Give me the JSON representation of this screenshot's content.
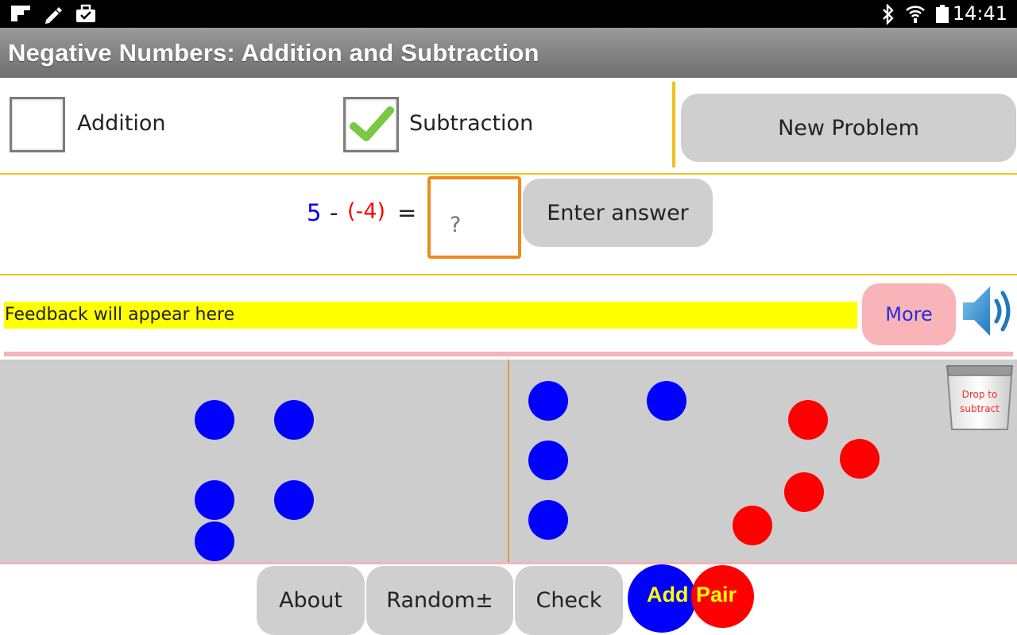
{
  "status_bar": {
    "time": "14:41",
    "icons": [
      "app-icon",
      "pencil-icon",
      "briefcase-icon",
      "bluetooth-icon",
      "wifi-icon",
      "battery-icon"
    ]
  },
  "title": "Negative Numbers: Addition and Subtraction",
  "options": {
    "addition": {
      "label": "Addition",
      "checked": false
    },
    "subtraction": {
      "label": "Subtraction",
      "checked": true
    }
  },
  "new_problem_label": "New Problem",
  "equation": {
    "first": "5",
    "operator": "-",
    "second": "(-4)",
    "equals": "=",
    "first_color": "#0000ff",
    "second_color": "#ff0000"
  },
  "answer": {
    "placeholder": "?",
    "value": ""
  },
  "enter_answer_label": "Enter answer",
  "feedback": "Feedback will appear here",
  "more_label": "More",
  "trash": {
    "label": "Drop to subtract"
  },
  "counters": {
    "left": {
      "positive": 5,
      "negative": 0
    },
    "right": {
      "positive": 4,
      "negative": 4
    }
  },
  "bottom": {
    "about": "About",
    "random": "Random±",
    "check": "Check",
    "add_pair_part1": "Add",
    "add_pair_part2": "Pair"
  },
  "colors": {
    "positive": "#0000ff",
    "negative": "#ff0000",
    "feedback_bg": "#ffff00",
    "accent": "#f2c21b",
    "button_bg": "#cfcfcf",
    "more_bg": "#f8b4b8",
    "answer_border": "#f08a1c"
  }
}
